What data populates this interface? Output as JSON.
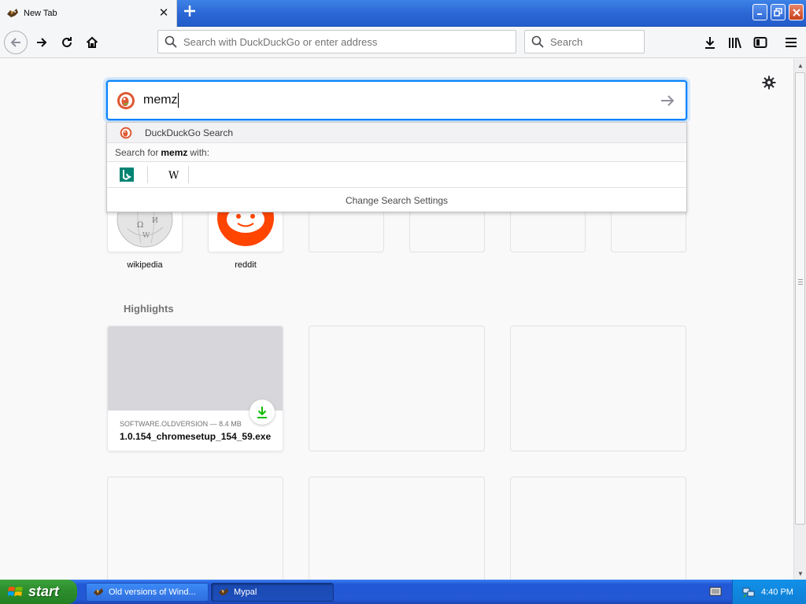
{
  "browser": {
    "tab": {
      "title": "New Tab"
    },
    "urlbar": {
      "placeholder": "Search with DuckDuckGo or enter address"
    },
    "searchbar": {
      "placeholder": "Search"
    }
  },
  "newtab": {
    "search": {
      "query": "memz"
    },
    "suggestions": {
      "engine_label": "DuckDuckGo Search",
      "search_for_prefix": "Search for",
      "search_for_term": "memz",
      "search_for_suffix": "with:",
      "alt_engines": [
        "bing",
        "wikipedia"
      ],
      "change_settings": "Change Search Settings"
    },
    "top_sites": [
      {
        "label": "wikipedia"
      },
      {
        "label": "reddit"
      }
    ],
    "highlights": {
      "title": "Highlights",
      "card": {
        "meta": "SOFTWARE.OLDVERSION — 8.4 MB",
        "filename": "1.0.154_chromesetup_154_59.exe"
      }
    }
  },
  "taskbar": {
    "start_label": "start",
    "tasks": [
      {
        "label": "Old versions of Wind..."
      },
      {
        "label": "Mypal"
      }
    ],
    "clock": "4:40 PM"
  },
  "colors": {
    "accent": "#0a84ff",
    "download_green": "#12bc00",
    "ddg_orange": "#de5833",
    "reddit_orange": "#ff4500"
  }
}
